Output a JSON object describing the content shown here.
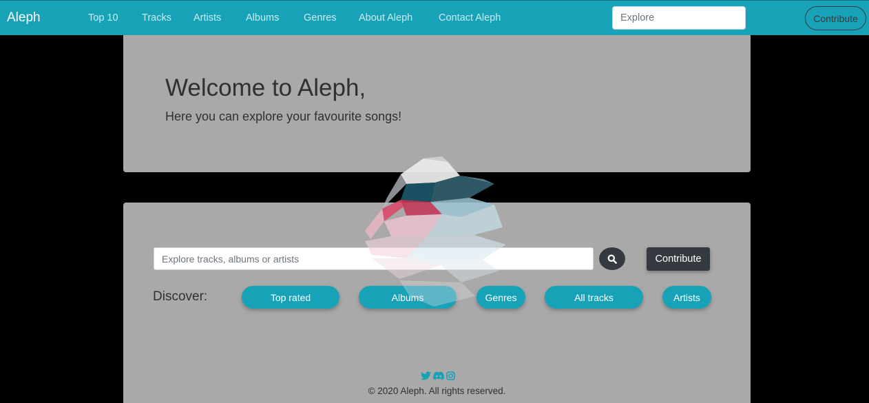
{
  "brand": "Aleph",
  "nav": {
    "links": [
      "Top 10",
      "Tracks",
      "Artists",
      "Albums",
      "Genres",
      "About Aleph",
      "Contact Aleph"
    ],
    "search_placeholder": "Explore",
    "contribute_label": "Contribute"
  },
  "hero": {
    "title": "Welcome to Aleph,",
    "subtitle": "Here you can explore your favourite songs!"
  },
  "search": {
    "placeholder": "Explore tracks, albums or artists",
    "button_icon": "search-icon",
    "contribute_label": "Contribute"
  },
  "discover": {
    "label": "Discover:",
    "buttons": [
      "Top rated",
      "Albums",
      "Genres",
      "All tracks",
      "Artists"
    ]
  },
  "footer": {
    "social_icons": [
      "twitter-icon",
      "discord-icon",
      "instagram-icon"
    ],
    "copyright": "© 2020 Aleph. All rights reserved."
  },
  "colors": {
    "accent": "#17a2b8",
    "dark": "#343a40",
    "card_bg": "#a9a9a9",
    "page_bg": "#000000"
  }
}
